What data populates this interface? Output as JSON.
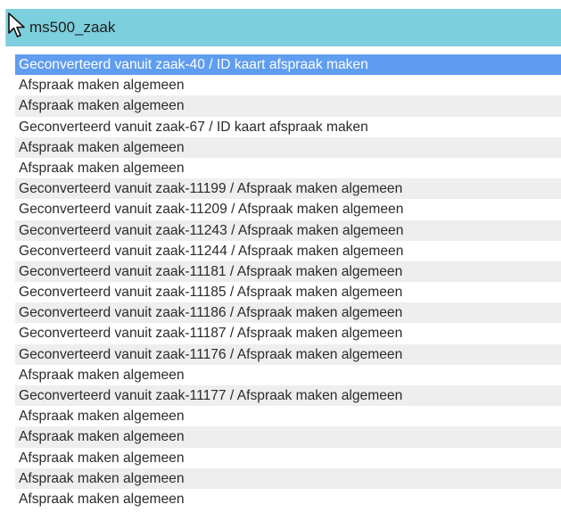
{
  "header": {
    "label": "ms500_zaak"
  },
  "colors": {
    "header_bg": "#7ccfdd",
    "selected_bg": "#5f9df0",
    "row_shade": "#eeeeee"
  },
  "list": {
    "selected_index": 0,
    "items": [
      "Geconverteerd vanuit zaak-40 / ID kaart afspraak maken",
      "Afspraak maken algemeen",
      "Afspraak maken algemeen",
      "Geconverteerd vanuit zaak-67 / ID kaart afspraak maken",
      "Afspraak maken algemeen",
      "Afspraak maken algemeen",
      "Geconverteerd vanuit zaak-11199 / Afspraak maken algemeen",
      "Geconverteerd vanuit zaak-11209 / Afspraak maken algemeen",
      "Geconverteerd vanuit zaak-11243 / Afspraak maken algemeen",
      "Geconverteerd vanuit zaak-11244 / Afspraak maken algemeen",
      "Geconverteerd vanuit zaak-11181 / Afspraak maken algemeen",
      "Geconverteerd vanuit zaak-11185 / Afspraak maken algemeen",
      "Geconverteerd vanuit zaak-11186 / Afspraak maken algemeen",
      "Geconverteerd vanuit zaak-11187 / Afspraak maken algemeen",
      "Geconverteerd vanuit zaak-11176 / Afspraak maken algemeen",
      "Afspraak maken algemeen",
      "Geconverteerd vanuit zaak-11177 / Afspraak maken algemeen",
      "Afspraak maken algemeen",
      "Afspraak maken algemeen",
      "Afspraak maken algemeen",
      "Afspraak maken algemeen",
      "Afspraak maken algemeen"
    ]
  }
}
